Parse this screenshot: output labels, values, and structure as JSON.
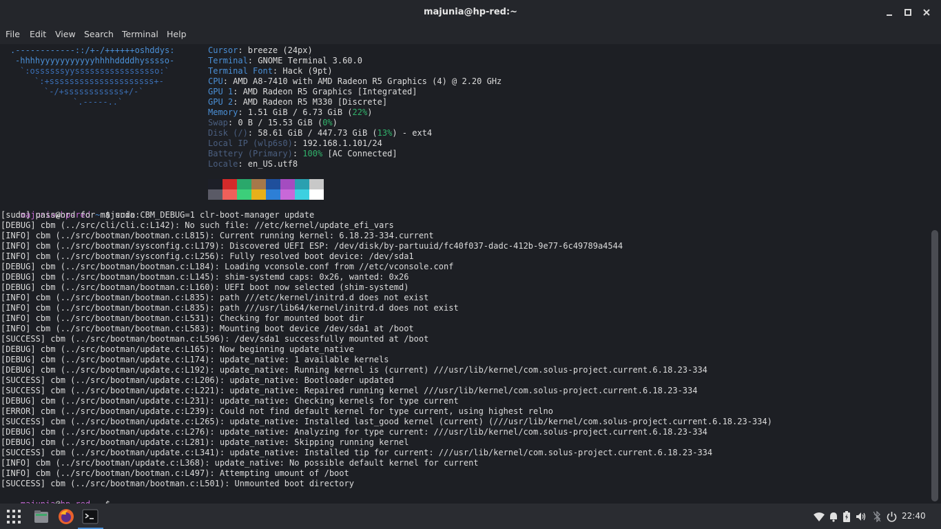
{
  "window": {
    "title": "majunia@hp-red:~"
  },
  "menu": [
    "File",
    "Edit",
    "View",
    "Search",
    "Terminal",
    "Help"
  ],
  "logo_lines": [
    ".------------::/+-/++++++oshddys:",
    "-hhhhyyyyyyyyyyyhhhhddddhysssso-",
    "`:ossssssyysssssssssssssssso:`",
    "`:+sssssssssssssssssssss+-",
    "`-/+ssssssssssss+/-`",
    "`.-----..`"
  ],
  "sysinfo": [
    {
      "label": "Cursor",
      "value": ": breeze (24px)"
    },
    {
      "label": "Terminal",
      "value": ": GNOME Terminal 3.60.0"
    },
    {
      "label": "Terminal Font",
      "value": ": Hack (9pt)"
    },
    {
      "label": "CPU",
      "value": ": AMD A8-7410 with AMD Radeon R5 Graphics (4) @ 2.20 GHz"
    },
    {
      "label": "GPU 1",
      "value": ": AMD Radeon R5 Graphics [Integrated]"
    },
    {
      "label": "GPU 2",
      "value": ": AMD Radeon R5 M330 [Discrete]"
    },
    {
      "label": "Memory",
      "value": ": 1.51 GiB / 6.73 GiB (",
      "pct": "22%",
      "tail": ")"
    },
    {
      "label": "Swap",
      "value": ": 0 B / 15.53 GiB (",
      "pct": "0%",
      "tail": ")"
    },
    {
      "label": "Disk (/)",
      "value": ": 58.61 GiB / 447.73 GiB (",
      "pct": "13%",
      "tail": ") - ext4"
    },
    {
      "label": "Local IP (wlp6s0)",
      "value": ": 192.168.1.101/24"
    },
    {
      "label": "Battery (Primary)",
      "value": ": ",
      "pct": "100%",
      "tail": " [AC Connected]"
    },
    {
      "label": "Locale",
      "value": ": en_US.utf8"
    }
  ],
  "palette_top": [
    "#1d1f28",
    "#d42a2a",
    "#2aa86b",
    "#a6784a",
    "#1f4f9c",
    "#a44cc0",
    "#2aa0b0",
    "#c8c8c8"
  ],
  "palette_bottom": [
    "#5a5a66",
    "#f0605a",
    "#3ccf7a",
    "#e8b01a",
    "#2d7fd6",
    "#c868d8",
    "#3cd0e0",
    "#ffffff"
  ],
  "prompt": {
    "user": "majunia",
    "at": "@",
    "host": "hp-red",
    "path": " ~ ",
    "sign": "$ "
  },
  "command": "sudo CBM_DEBUG=1 clr-boot-manager update",
  "output": [
    "[sudo] password for majunia:",
    "[DEBUG] cbm (../src/cli/cli.c:L142): No such file: //etc/kernel/update_efi_vars",
    "[INFO] cbm (../src/bootman/bootman.c:L815): Current running kernel: 6.18.23-334.current",
    "[INFO] cbm (../src/bootman/sysconfig.c:L179): Discovered UEFI ESP: /dev/disk/by-partuuid/fc40f037-dadc-412b-9e77-6c49789a4544",
    "[INFO] cbm (../src/bootman/sysconfig.c:L256): Fully resolved boot device: /dev/sda1",
    "[DEBUG] cbm (../src/bootman/bootman.c:L184): Loading vconsole.conf from //etc/vconsole.conf",
    "[DEBUG] cbm (../src/bootman/bootman.c:L145): shim-systemd caps: 0x26, wanted: 0x26",
    "[DEBUG] cbm (../src/bootman/bootman.c:L160): UEFI boot now selected (shim-systemd)",
    "[INFO] cbm (../src/bootman/bootman.c:L835): path ///etc/kernel/initrd.d does not exist",
    "[INFO] cbm (../src/bootman/bootman.c:L835): path ///usr/lib64/kernel/initrd.d does not exist",
    "[INFO] cbm (../src/bootman/bootman.c:L531): Checking for mounted boot dir",
    "[INFO] cbm (../src/bootman/bootman.c:L583): Mounting boot device /dev/sda1 at /boot",
    "[SUCCESS] cbm (../src/bootman/bootman.c:L596): /dev/sda1 successfully mounted at /boot",
    "[DEBUG] cbm (../src/bootman/update.c:L165): Now beginning update_native",
    "[DEBUG] cbm (../src/bootman/update.c:L174): update_native: 1 available kernels",
    "[DEBUG] cbm (../src/bootman/update.c:L192): update_native: Running kernel is (current) ///usr/lib/kernel/com.solus-project.current.6.18.23-334",
    "[SUCCESS] cbm (../src/bootman/update.c:L206): update_native: Bootloader updated",
    "[SUCCESS] cbm (../src/bootman/update.c:L221): update_native: Repaired running kernel ///usr/lib/kernel/com.solus-project.current.6.18.23-334",
    "[DEBUG] cbm (../src/bootman/update.c:L231): update_native: Checking kernels for type current",
    "[ERROR] cbm (../src/bootman/update.c:L239): Could not find default kernel for type current, using highest relno",
    "[SUCCESS] cbm (../src/bootman/update.c:L265): update_native: Installed last_good kernel (current) (///usr/lib/kernel/com.solus-project.current.6.18.23-334)",
    "[DEBUG] cbm (../src/bootman/update.c:L276): update_native: Analyzing for type current: ///usr/lib/kernel/com.solus-project.current.6.18.23-334",
    "[DEBUG] cbm (../src/bootman/update.c:L281): update_native: Skipping running kernel",
    "[SUCCESS] cbm (../src/bootman/update.c:L341): update_native: Installed tip for current: ///usr/lib/kernel/com.solus-project.current.6.18.23-334",
    "[INFO] cbm (../src/bootman/update.c:L368): update_native: No possible default kernel for current",
    "[INFO] cbm (../src/bootman/bootman.c:L497): Attempting umount of /boot",
    "[SUCCESS] cbm (../src/bootman/bootman.c:L501): Unmounted boot directory"
  ],
  "taskbar": {
    "apps": [
      "app-grid-icon",
      "file-manager-icon",
      "firefox-icon",
      "terminal-icon"
    ],
    "tray": [
      "wifi-icon",
      "notification-bell-icon",
      "battery-icon",
      "volume-icon",
      "bluetooth-icon",
      "power-icon"
    ],
    "clock": "22:40"
  }
}
